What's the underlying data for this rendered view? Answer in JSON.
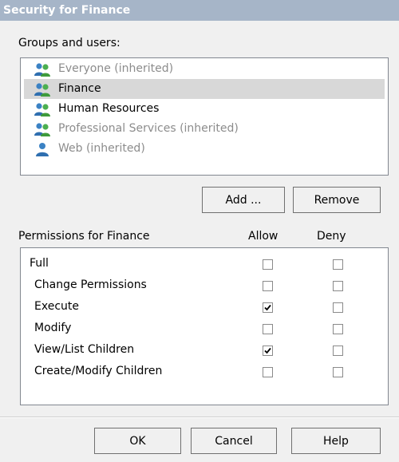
{
  "window": {
    "title": "Security for Finance"
  },
  "groups": {
    "label": "Groups and users:",
    "items": [
      {
        "name": "Everyone (inherited)",
        "icon": "group-icon",
        "inherited": true,
        "selected": false
      },
      {
        "name": "Finance",
        "icon": "group-icon",
        "inherited": false,
        "selected": true
      },
      {
        "name": "Human Resources",
        "icon": "group-icon",
        "inherited": false,
        "selected": false
      },
      {
        "name": "Professional Services (inherited)",
        "icon": "group-icon",
        "inherited": true,
        "selected": false
      },
      {
        "name": "Web (inherited)",
        "icon": "user-icon",
        "inherited": true,
        "selected": false
      }
    ],
    "add_label": "Add ...",
    "remove_label": "Remove"
  },
  "permissions": {
    "label": "Permissions for Finance",
    "allow_label": "Allow",
    "deny_label": "Deny",
    "rows": [
      {
        "name": "Full",
        "indent": false,
        "allow": false,
        "deny": false
      },
      {
        "name": "Change Permissions",
        "indent": true,
        "allow": false,
        "deny": false
      },
      {
        "name": "Execute",
        "indent": true,
        "allow": true,
        "deny": false
      },
      {
        "name": "Modify",
        "indent": true,
        "allow": false,
        "deny": false
      },
      {
        "name": "View/List Children",
        "indent": true,
        "allow": true,
        "deny": false
      },
      {
        "name": "Create/Modify Children",
        "indent": true,
        "allow": false,
        "deny": false
      }
    ]
  },
  "footer": {
    "ok_label": "OK",
    "cancel_label": "Cancel",
    "help_label": "Help"
  }
}
